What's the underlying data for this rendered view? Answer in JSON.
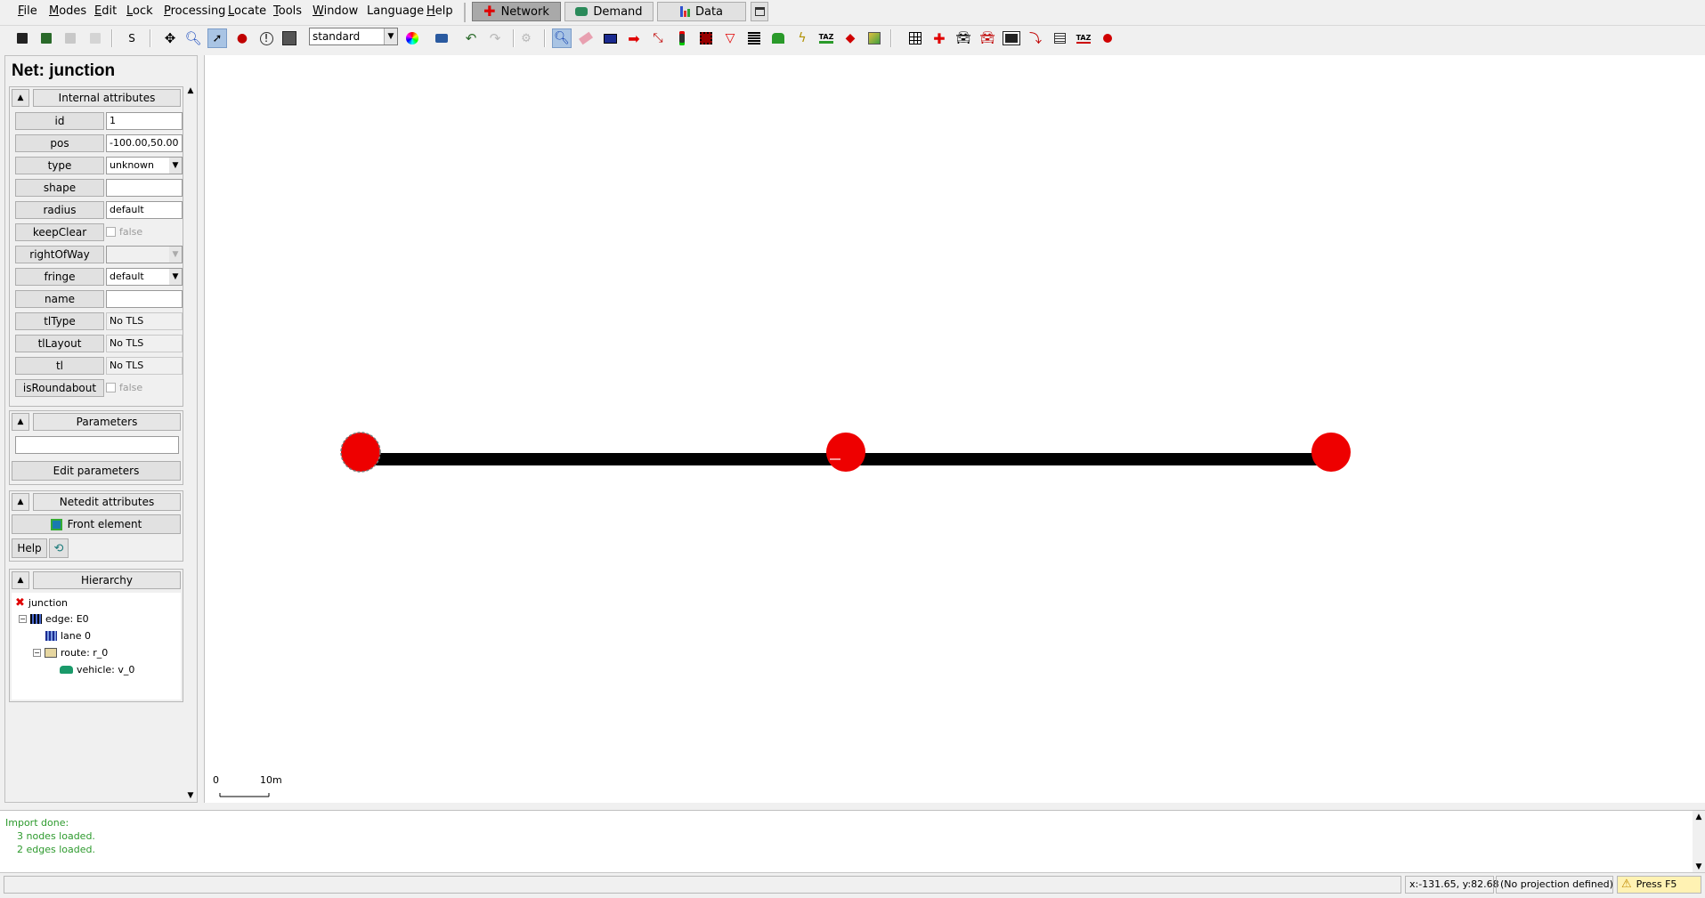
{
  "menubar": {
    "items": [
      {
        "label": "File",
        "u": "F",
        "rest": "ile"
      },
      {
        "label": "Modes",
        "u": "M",
        "rest": "odes"
      },
      {
        "label": "Edit",
        "u": "E",
        "rest": "dit"
      },
      {
        "label": "Lock",
        "u": "L",
        "rest": "ock"
      },
      {
        "label": "Processing",
        "u": "P",
        "rest": "rocessing"
      },
      {
        "label": "Locate",
        "u": "L",
        "rest": "ocate"
      },
      {
        "label": "Tools",
        "u": "T",
        "rest": "ools"
      },
      {
        "label": "Window",
        "u": "W",
        "rest": "indow"
      },
      {
        "label": "Language",
        "u": "",
        "rest": "Language"
      },
      {
        "label": "Help",
        "u": "H",
        "rest": "elp"
      }
    ],
    "supermodes": {
      "network": "Network",
      "demand": "Demand",
      "data": "Data"
    }
  },
  "toolbar": {
    "scheme": "standard",
    "s_label": "S"
  },
  "frame": {
    "title": "Net: junction"
  },
  "internal_attributes": {
    "header": "Internal attributes",
    "rows": {
      "id": {
        "name": "id",
        "value": "1"
      },
      "pos": {
        "name": "pos",
        "value": "-100.00,50.00"
      },
      "type": {
        "name": "type",
        "value": "unknown"
      },
      "shape": {
        "name": "shape",
        "value": ""
      },
      "radius": {
        "name": "radius",
        "value": "default"
      },
      "keepClear": {
        "name": "keepClear",
        "value": "false"
      },
      "rightOfWay": {
        "name": "rightOfWay",
        "value": ""
      },
      "fringe": {
        "name": "fringe",
        "value": "default"
      },
      "name": {
        "name": "name",
        "value": ""
      },
      "tlType": {
        "name": "tlType",
        "value": "No TLS"
      },
      "tlLayout": {
        "name": "tlLayout",
        "value": "No TLS"
      },
      "tl": {
        "name": "tl",
        "value": "No TLS"
      },
      "isRoundabout": {
        "name": "isRoundabout",
        "value": "false"
      }
    }
  },
  "parameters": {
    "header": "Parameters",
    "value": "",
    "edit_button": "Edit parameters"
  },
  "netedit_attributes": {
    "header": "Netedit attributes",
    "front_button": "Front element",
    "help_button": "Help"
  },
  "hierarchy": {
    "header": "Hierarchy",
    "items": {
      "junction": "junction",
      "edge": "edge: E0",
      "lane": "lane 0",
      "route": "route: r_0",
      "vehicle": "vehicle: v_0"
    }
  },
  "canvas": {
    "scale_zero": "0",
    "scale_label": "10m",
    "junction_color": "#ee0000",
    "edge_color": "#000000"
  },
  "messages": [
    "Import done:",
    "  3 nodes loaded.",
    "  2 edges loaded."
  ],
  "statusbar": {
    "coords": "x:-131.65, y:82.68",
    "projection": "(No projection defined)",
    "press": "Press F5"
  }
}
